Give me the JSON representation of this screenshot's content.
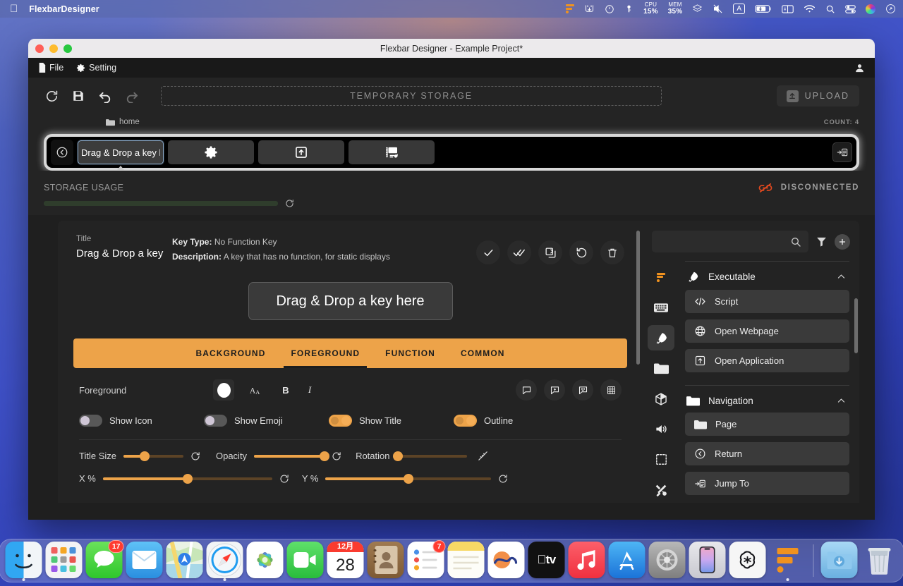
{
  "menubar": {
    "apple_icon": "apple-logo",
    "app_name": "FlexbarDesigner",
    "status_items": [
      {
        "name": "flexbar-menu-icon",
        "label": ""
      },
      {
        "name": "stats-menu-icon",
        "label": ""
      },
      {
        "name": "clock-dial-icon",
        "label": ""
      },
      {
        "name": "key-icon",
        "label": ""
      },
      {
        "name": "cpu-stat",
        "top": "CPU",
        "value": "15%"
      },
      {
        "name": "mem-stat",
        "top": "MEM",
        "value": "35%"
      },
      {
        "name": "layers-icon",
        "label": ""
      },
      {
        "name": "mute-icon",
        "label": ""
      },
      {
        "name": "input-source-icon",
        "label": "A"
      },
      {
        "name": "battery-icon",
        "label": ""
      },
      {
        "name": "display-icon",
        "label": ""
      },
      {
        "name": "wifi-icon",
        "label": ""
      },
      {
        "name": "spotlight-search-icon",
        "label": ""
      },
      {
        "name": "control-center-icon",
        "label": ""
      },
      {
        "name": "siri-icon",
        "label": ""
      },
      {
        "name": "notification-center-icon",
        "label": ""
      }
    ]
  },
  "window": {
    "title": "Flexbar Designer - Example Project*",
    "menu": {
      "file": "File",
      "setting": "Setting",
      "account_icon": "user-account-icon"
    }
  },
  "toolbar": {
    "refresh_icon": "refresh-icon",
    "save_icon": "save-icon",
    "undo_icon": "undo-icon",
    "redo_icon": "redo-icon",
    "temp_storage_label": "TEMPORARY STORAGE",
    "upload_label": "UPLOAD"
  },
  "breadcrumb": {
    "folder_label": "home",
    "count_label": "COUNT: 4"
  },
  "device": {
    "nav_back_icon": "chevron-left-circle-icon",
    "menu_icon": "list-panel-icon",
    "keys": [
      {
        "name": "key-drag-drop",
        "label": "Drag & Drop a key here",
        "type": "text",
        "selected": true
      },
      {
        "name": "key-settings",
        "label": "",
        "type": "gear-icon",
        "selected": false
      },
      {
        "name": "key-open-application",
        "label": "",
        "type": "open-application-icon",
        "selected": false
      },
      {
        "name": "key-media-script",
        "label": "",
        "type": "media-script-icon",
        "selected": false
      }
    ]
  },
  "storage": {
    "label": "STORAGE USAGE",
    "refresh_icon": "refresh-icon",
    "fill_percent": 100,
    "connection_status": "DISCONNECTED",
    "connection_icon": "broken-link-icon",
    "connection_color": "#e2491f"
  },
  "editor": {
    "title_label": "Title",
    "title_value": "Drag & Drop a key",
    "key_type_label": "Key Type:",
    "key_type_value": "No Function Key",
    "description_label": "Description:",
    "description_value": "A key that has no function, for static displays",
    "actions": [
      {
        "name": "apply-button",
        "icon": "check-icon"
      },
      {
        "name": "apply-all-button",
        "icon": "double-check-icon"
      },
      {
        "name": "duplicate-button",
        "icon": "copy-icon"
      },
      {
        "name": "reset-button",
        "icon": "refresh-icon"
      },
      {
        "name": "delete-button",
        "icon": "trash-icon"
      }
    ],
    "preview_text": "Drag & Drop a key here",
    "tabs": [
      {
        "label": "BACKGROUND",
        "active": false
      },
      {
        "label": "FOREGROUND",
        "active": true
      },
      {
        "label": "FUNCTION",
        "active": false
      },
      {
        "label": "COMMON",
        "active": false
      }
    ],
    "foreground": {
      "label": "Foreground",
      "color": "#ffffff",
      "font_size_icon": "font-size-icon",
      "bold_label": "B",
      "italic_label": "I",
      "right_icons": [
        {
          "name": "text-shape-icon"
        },
        {
          "name": "add-layer-icon"
        },
        {
          "name": "emoji-icon"
        },
        {
          "name": "grid-icon"
        }
      ],
      "toggles": [
        {
          "name": "show-icon-toggle",
          "label": "Show Icon",
          "on": false
        },
        {
          "name": "show-emoji-toggle",
          "label": "Show Emoji",
          "on": false
        },
        {
          "name": "show-title-toggle",
          "label": "Show Title",
          "on": true
        },
        {
          "name": "outline-toggle",
          "label": "Outline",
          "on": true
        }
      ],
      "sliders": [
        {
          "name": "title-size-slider",
          "label": "Title Size",
          "percent": 35,
          "reset_icon": "reset-icon"
        },
        {
          "name": "opacity-slider",
          "label": "Opacity",
          "percent": 100,
          "reset_icon": "reset-icon"
        },
        {
          "name": "rotation-slider",
          "label": "Rotation",
          "percent": 2,
          "reset_icon": "ruler-icon"
        }
      ],
      "sliders_row2": [
        {
          "name": "x-percent-slider",
          "label": "X %",
          "percent": 50,
          "reset_icon": "reset-icon"
        },
        {
          "name": "y-percent-slider",
          "label": "Y %",
          "percent": 50,
          "reset_icon": "reset-icon"
        }
      ]
    }
  },
  "right_panel": {
    "search_placeholder": "",
    "search_value": "",
    "search_icon": "search-icon",
    "filter_icon": "filter-icon",
    "add_icon": "plus-icon",
    "rail": [
      {
        "name": "rail-flexbar",
        "icon": "flexbar-logo-icon",
        "active": false
      },
      {
        "name": "rail-keyboard",
        "icon": "keyboard-icon",
        "active": false
      },
      {
        "name": "rail-executable",
        "icon": "rocket-icon",
        "active": true
      },
      {
        "name": "rail-navigation",
        "icon": "folder-icon",
        "active": false
      },
      {
        "name": "rail-plugins",
        "icon": "package-icon",
        "active": false
      },
      {
        "name": "rail-audio",
        "icon": "speaker-icon",
        "active": false
      },
      {
        "name": "rail-selection",
        "icon": "marquee-icon",
        "active": false
      },
      {
        "name": "rail-tools",
        "icon": "tools-icon",
        "active": false
      }
    ],
    "sections": [
      {
        "name": "executable",
        "title": "Executable",
        "icon": "rocket-icon",
        "chevron": "chevron-up-icon",
        "items": [
          {
            "name": "item-script",
            "label": "Script",
            "icon": "code-icon"
          },
          {
            "name": "item-open-webpage",
            "label": "Open Webpage",
            "icon": "globe-icon"
          },
          {
            "name": "item-open-application",
            "label": "Open Application",
            "icon": "open-application-icon"
          }
        ]
      },
      {
        "name": "navigation",
        "title": "Navigation",
        "icon": "folder-icon",
        "chevron": "chevron-up-icon",
        "items": [
          {
            "name": "item-page",
            "label": "Page",
            "icon": "folder-icon"
          },
          {
            "name": "item-return",
            "label": "Return",
            "icon": "back-circle-icon"
          },
          {
            "name": "item-jump-to",
            "label": "Jump To",
            "icon": "jump-to-icon"
          }
        ]
      }
    ]
  },
  "dock": {
    "items": [
      {
        "name": "dock-finder",
        "label": "Finder",
        "badge": "",
        "running": true
      },
      {
        "name": "dock-launchpad",
        "label": "Launchpad",
        "badge": "",
        "running": false
      },
      {
        "name": "dock-messages",
        "label": "Messages",
        "badge": "17",
        "running": false
      },
      {
        "name": "dock-mail",
        "label": "Mail",
        "badge": "",
        "running": false
      },
      {
        "name": "dock-maps",
        "label": "Maps",
        "badge": "",
        "running": false
      },
      {
        "name": "dock-safari",
        "label": "Safari",
        "badge": "",
        "running": true
      },
      {
        "name": "dock-photos",
        "label": "Photos",
        "badge": "",
        "running": false
      },
      {
        "name": "dock-facetime",
        "label": "FaceTime",
        "badge": "",
        "running": false
      },
      {
        "name": "dock-calendar",
        "label": "Calendar",
        "badge": "",
        "running": false,
        "month": "12月",
        "day": "28"
      },
      {
        "name": "dock-contacts",
        "label": "Contacts",
        "badge": "",
        "running": false
      },
      {
        "name": "dock-reminders",
        "label": "Reminders",
        "badge": "7",
        "running": false
      },
      {
        "name": "dock-notes",
        "label": "Notes",
        "badge": "",
        "running": false
      },
      {
        "name": "dock-freeform",
        "label": "Freeform",
        "badge": "",
        "running": false
      },
      {
        "name": "dock-appletv",
        "label": "Apple TV",
        "badge": "",
        "running": false
      },
      {
        "name": "dock-music",
        "label": "Music",
        "badge": "",
        "running": false
      },
      {
        "name": "dock-appstore",
        "label": "App Store",
        "badge": "",
        "running": false
      },
      {
        "name": "dock-settings",
        "label": "System Settings",
        "badge": "",
        "running": false
      },
      {
        "name": "dock-iphone-mirroring",
        "label": "iPhone Mirroring",
        "badge": "",
        "running": false
      },
      {
        "name": "dock-chatgpt",
        "label": "ChatGPT",
        "badge": "",
        "running": false
      },
      {
        "name": "dock-flexbar",
        "label": "FlexbarDesigner",
        "badge": "",
        "running": true
      },
      {
        "name": "dock-downloads",
        "label": "Downloads",
        "badge": "",
        "running": false
      },
      {
        "name": "dock-trash",
        "label": "Trash",
        "badge": "",
        "running": false
      }
    ]
  }
}
